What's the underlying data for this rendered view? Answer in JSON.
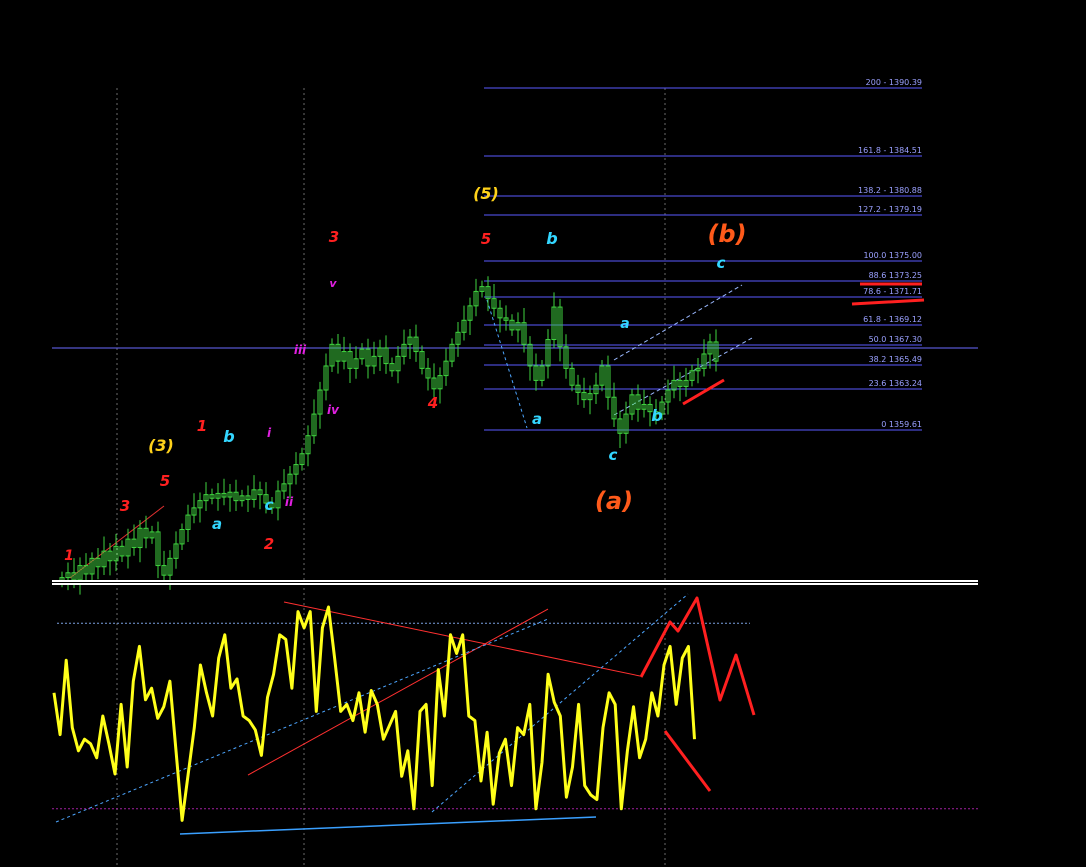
{
  "colors": {
    "background": "#000000",
    "candles": "#3fd43f",
    "oscillator": "#ffff1a",
    "fib_lines": "#5a5aff",
    "fib_text": "#9aa0ff",
    "red": "#ff2020",
    "cyan": "#33d6ff",
    "yellow": "#ffd21a",
    "magenta": "#e020e0",
    "orange": "#ff5a1a",
    "channel": "#4da6ff",
    "hline": "#6a6aff"
  },
  "chart_data": [
    {
      "type": "candlestick",
      "title": "",
      "xlabel": "",
      "ylabel": "",
      "ylim": [
        1349,
        1391
      ],
      "grid": "vertical dashed separators",
      "price_series": [
        1349.2,
        1349.6,
        1349.0,
        1350.2,
        1349.5,
        1350.8,
        1350.1,
        1351.4,
        1350.6,
        1351.8,
        1351.0,
        1352.4,
        1351.7,
        1353.3,
        1352.5,
        1353.0,
        1350.2,
        1349.4,
        1350.8,
        1352.0,
        1353.2,
        1354.4,
        1355.0,
        1355.6,
        1356.1,
        1355.8,
        1356.2,
        1355.9,
        1356.3,
        1355.6,
        1356.0,
        1355.7,
        1356.5,
        1356.1,
        1355.4,
        1355.0,
        1356.4,
        1357.0,
        1357.8,
        1358.6,
        1359.5,
        1361.0,
        1362.8,
        1364.8,
        1366.8,
        1368.6,
        1367.2,
        1368.0,
        1366.6,
        1367.4,
        1368.2,
        1366.8,
        1367.6,
        1368.3,
        1367.0,
        1366.4,
        1367.6,
        1368.6,
        1369.2,
        1368.0,
        1366.6,
        1365.8,
        1364.9,
        1366.0,
        1367.2,
        1368.6,
        1369.6,
        1370.6,
        1371.8,
        1373.0,
        1373.4,
        1372.4,
        1371.6,
        1370.8,
        1370.6,
        1369.8,
        1370.4,
        1368.6,
        1366.8,
        1365.6,
        1366.8,
        1369.0,
        1371.7,
        1368.4,
        1366.6,
        1365.2,
        1364.6,
        1364.0,
        1364.5,
        1365.2,
        1366.8,
        1364.2,
        1362.4,
        1361.2,
        1362.8,
        1364.4,
        1363.2,
        1363.6,
        1363.0,
        1362.8,
        1363.8,
        1364.8,
        1365.6,
        1365.1,
        1365.6,
        1366.4,
        1366.6,
        1367.8,
        1368.8,
        1367.2
      ],
      "fibonacci_levels": [
        {
          "ratio": "200",
          "label": "200 - 1390.39"
        },
        {
          "ratio": "161.8",
          "label": "161.8 - 1384.51"
        },
        {
          "ratio": "138.2",
          "label": "138.2 - 1380.88"
        },
        {
          "ratio": "127.2",
          "label": "127.2 - 1379.19"
        },
        {
          "ratio": "100.0",
          "label": "100.0 1375.00"
        },
        {
          "ratio": "88.6",
          "label": "88.6 1373.25"
        },
        {
          "ratio": "78.6",
          "label": "78.6 - 1371.71"
        },
        {
          "ratio": "61.8",
          "label": "61.8 - 1369.12"
        },
        {
          "ratio": "50.0",
          "label": "50.0 1367.30"
        },
        {
          "ratio": "38.2",
          "label": "38.2 1365.49"
        },
        {
          "ratio": "23.6",
          "label": "23.6 1363.24"
        },
        {
          "ratio": "0",
          "label": "0 1359.61"
        }
      ],
      "wave_labels": [
        {
          "text": "1",
          "color": "red"
        },
        {
          "text": "3",
          "color": "red"
        },
        {
          "text": "5",
          "color": "red"
        },
        {
          "text": "(3)",
          "color": "yellow"
        },
        {
          "text": "a",
          "color": "cyan"
        },
        {
          "text": "b",
          "color": "cyan"
        },
        {
          "text": "c",
          "color": "cyan"
        },
        {
          "text": "1",
          "color": "red"
        },
        {
          "text": "2",
          "color": "red"
        },
        {
          "text": "i",
          "color": "magenta"
        },
        {
          "text": "ii",
          "color": "magenta"
        },
        {
          "text": "iii",
          "color": "magenta"
        },
        {
          "text": "iv",
          "color": "magenta"
        },
        {
          "text": "v",
          "color": "magenta"
        },
        {
          "text": "3",
          "color": "red"
        },
        {
          "text": "4",
          "color": "red"
        },
        {
          "text": "5",
          "color": "red"
        },
        {
          "text": "(5)",
          "color": "yellow"
        },
        {
          "text": "a",
          "color": "cyan"
        },
        {
          "text": "b",
          "color": "cyan"
        },
        {
          "text": "c",
          "color": "cyan"
        },
        {
          "text": "a",
          "color": "cyan"
        },
        {
          "text": "b",
          "color": "cyan"
        },
        {
          "text": "c",
          "color": "cyan"
        },
        {
          "text": "(a)",
          "color": "orange"
        },
        {
          "text": "(b)",
          "color": "orange"
        }
      ]
    },
    {
      "type": "line",
      "title": "",
      "name": "",
      "ylim": [
        0,
        100
      ],
      "levels": [
        90,
        10
      ],
      "values": [
        60,
        42,
        74,
        45,
        35,
        40,
        38,
        32,
        50,
        38,
        25,
        55,
        28,
        65,
        80,
        57,
        62,
        49,
        54,
        65,
        35,
        5,
        25,
        45,
        72,
        60,
        50,
        75,
        85,
        62,
        66,
        50,
        48,
        44,
        33,
        58,
        68,
        85,
        83,
        62,
        95,
        88,
        95,
        52,
        88,
        97,
        75,
        52,
        55,
        48,
        60,
        43,
        61,
        55,
        40,
        46,
        52,
        24,
        35,
        10,
        52,
        55,
        20,
        70,
        50,
        85,
        77,
        85,
        50,
        48,
        22,
        43,
        12,
        34,
        40,
        20,
        45,
        42,
        55,
        10,
        30,
        68,
        56,
        50,
        15,
        28,
        55,
        20,
        16,
        14,
        45,
        60,
        55,
        10,
        35,
        54,
        32,
        40,
        60,
        50,
        72,
        80,
        55,
        75,
        80,
        40
      ]
    }
  ]
}
